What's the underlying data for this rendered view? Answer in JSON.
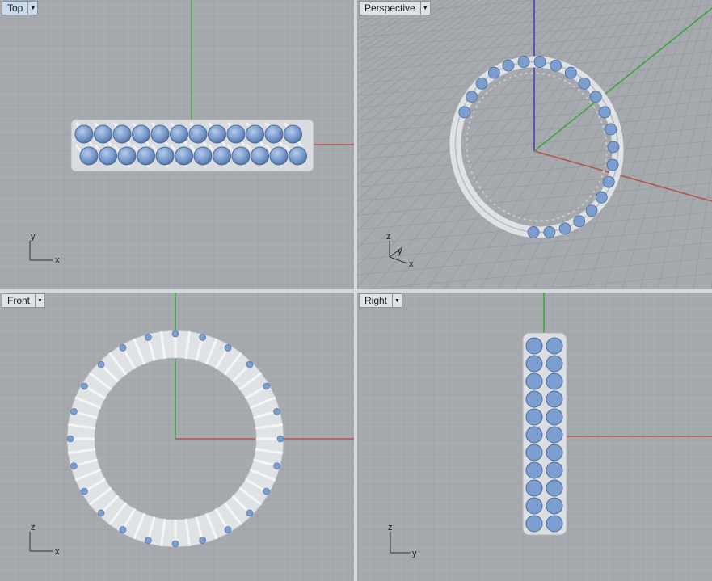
{
  "viewports": {
    "top": {
      "name": "Top",
      "menu_icon": "triangle-down",
      "axes": [
        "x",
        "y"
      ]
    },
    "perspective": {
      "name": "Perspective",
      "menu_icon": "triangle-down",
      "axes": [
        "x",
        "y",
        "z"
      ]
    },
    "front": {
      "name": "Front",
      "menu_icon": "triangle-down",
      "axes": [
        "x",
        "z"
      ]
    },
    "right": {
      "name": "Right",
      "menu_icon": "triangle-down",
      "axes": [
        "y",
        "z"
      ]
    }
  },
  "active_viewport": "Top",
  "colors": {
    "viewport_bg": "#a6aaae",
    "grid_minor": "#9a9ea3",
    "grid_major": "#8c9095",
    "x_axis": "#b5524a",
    "y_axis": "#3aa43a",
    "z_axis": "#3a3ab0",
    "gem": "#7b9dd0",
    "metal": "#e2e4e6"
  }
}
